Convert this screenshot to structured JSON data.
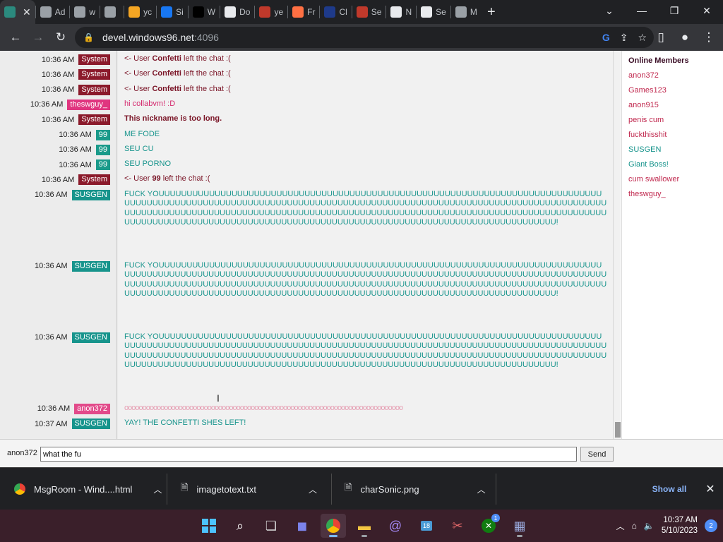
{
  "browser": {
    "tabs": [
      {
        "label": "",
        "color": "#2b8a7e",
        "active": true
      },
      {
        "label": "Ad",
        "color": "#9aa0a6"
      },
      {
        "label": "w",
        "color": "#9aa0a6"
      },
      {
        "label": "",
        "color": "#9aa0a6"
      },
      {
        "label": "yc",
        "color": "#f5a623"
      },
      {
        "label": "Si",
        "color": "#1877f2"
      },
      {
        "label": "W",
        "color": "#000000"
      },
      {
        "label": "Do",
        "color": "#e8eaed"
      },
      {
        "label": "ye",
        "color": "#c0392b"
      },
      {
        "label": "Fr",
        "color": "#ff7043"
      },
      {
        "label": "Cl",
        "color": "#1e3a8a"
      },
      {
        "label": "Se",
        "color": "#c0392b"
      },
      {
        "label": "N",
        "color": "#e8eaed"
      },
      {
        "label": "Se",
        "color": "#e8eaed"
      },
      {
        "label": "M",
        "color": "#9aa0a6"
      }
    ],
    "address_host": "devel.windows96.net",
    "address_port": ":4096"
  },
  "chat": {
    "messages": [
      {
        "time": "10:36 AM",
        "user": "System",
        "kind": "system",
        "prefix": "<- User ",
        "bold": "Confetti",
        "suffix": " left the chat :("
      },
      {
        "time": "10:36 AM",
        "user": "System",
        "kind": "system",
        "prefix": "<- User ",
        "bold": "Confetti",
        "suffix": " left the chat :("
      },
      {
        "time": "10:36 AM",
        "user": "System",
        "kind": "system",
        "prefix": "<- User ",
        "bold": "Confetti",
        "suffix": " left the chat :("
      },
      {
        "time": "10:36 AM",
        "user": "theswguy_",
        "kind": "swguy",
        "text": "hi collabvm! :D"
      },
      {
        "time": "10:36 AM",
        "user": "System",
        "kind": "system",
        "prefix": "",
        "bold": "This nickname is too long.",
        "suffix": ""
      },
      {
        "time": "10:36 AM",
        "user": "99",
        "kind": "n99",
        "text": "ME FODE"
      },
      {
        "time": "10:36 AM",
        "user": "99",
        "kind": "n99",
        "text": "SEU CU"
      },
      {
        "time": "10:36 AM",
        "user": "99",
        "kind": "n99",
        "text": "SEU PORNO"
      },
      {
        "time": "10:36 AM",
        "user": "System",
        "kind": "system",
        "prefix": "<- User ",
        "bold": "99",
        "suffix": " left the chat :("
      },
      {
        "time": "10:36 AM",
        "user": "SUSGEN",
        "kind": "susgen",
        "text": "FUCK YOUUUUUUUUUUUUUUUUUUUUUUUUUUUUUUUUUUUUUUUUUUUUUUUUUUUUUUUUUUUUUUUUUUUUUUUUUUUUUUUUUUUUUUUUUUUUUUUUUUUUUUUUUUUUUUUUUUUUUUUUUUUUUUUUUUUUUUUUUUUUUUUUUUUUUUUUUUUUUUUUUUUUUUUUUUUUUUUUUUUUUUUUUUUUUUUUUUUUUUUUUUUUUUUUUUUUUUUUUUUUUUUUUUUUUUUUUUUUUUUUUUUUUUUUUUUUUUUUUUUUUUUUUUUUUUUUUUUUUUUUUUUUUUUUUUUUUUUUUUUUUUUUUUUUUUUUUUUUUUUUUUUUUUUU!"
      },
      {
        "time": "10:36 AM",
        "user": "SUSGEN",
        "kind": "susgen",
        "text": "FUCK YOUUUUUUUUUUUUUUUUUUUUUUUUUUUUUUUUUUUUUUUUUUUUUUUUUUUUUUUUUUUUUUUUUUUUUUUUUUUUUUUUUUUUUUUUUUUUUUUUUUUUUUUUUUUUUUUUUUUUUUUUUUUUUUUUUUUUUUUUUUUUUUUUUUUUUUUUUUUUUUUUUUUUUUUUUUUUUUUUUUUUUUUUUUUUUUUUUUUUUUUUUUUUUUUUUUUUUUUUUUUUUUUUUUUUUUUUUUUUUUUUUUUUUUUUUUUUUUUUUUUUUUUUUUUUUUUUUUUUUUUUUUUUUUUUUUUUUUUUUUUUUUUUUUUUUUUUUUUUUUUUUUUUUUUU!"
      },
      {
        "time": "10:36 AM",
        "user": "SUSGEN",
        "kind": "susgen",
        "text": "FUCK YOUUUUUUUUUUUUUUUUUUUUUUUUUUUUUUUUUUUUUUUUUUUUUUUUUUUUUUUUUUUUUUUUUUUUUUUUUUUUUUUUUUUUUUUUUUUUUUUUUUUUUUUUUUUUUUUUUUUUUUUUUUUUUUUUUUUUUUUUUUUUUUUUUUUUUUUUUUUUUUUUUUUUUUUUUUUUUUUUUUUUUUUUUUUUUUUUUUUUUUUUUUUUUUUUUUUUUUUUUUUUUUUUUUUUUUUUUUUUUUUUUUUUUUUUUUUUUUUUUUUUUUUUUUUUUUUUUUUUUUUUUUUUUUUUUUUUUUUUUUUUUUUUUUUUUUUUUUUUUUUUUUUUUUUU!"
      },
      {
        "time": "10:36 AM",
        "user": "anon372",
        "kind": "anon",
        "text": "ooooooooooooooooooooooooooooooooooooooooooooooooooooooooooooooooooooooooooooo"
      },
      {
        "time": "10:37 AM",
        "user": "SUSGEN",
        "kind": "susgen",
        "text": "YAY! THE CONFETTI SHES LEFT!"
      }
    ]
  },
  "sidebar": {
    "title": "Online Members",
    "members": [
      {
        "name": "anon372",
        "color": "red"
      },
      {
        "name": "Games123",
        "color": "red"
      },
      {
        "name": "anon915",
        "color": "red"
      },
      {
        "name": "penis cum",
        "color": "red"
      },
      {
        "name": "fuckthisshit",
        "color": "red"
      },
      {
        "name": "SUSGEN",
        "color": "teal"
      },
      {
        "name": "Giant Boss!",
        "color": "teal"
      },
      {
        "name": "cum swallower",
        "color": "red"
      },
      {
        "name": "theswguy_",
        "color": "red"
      }
    ]
  },
  "input": {
    "nick": "anon372",
    "value": "what the fu",
    "send_label": "Send"
  },
  "downloads": {
    "items": [
      {
        "name": "MsgRoom - Wind....html",
        "icon": "chrome-file-icon"
      },
      {
        "name": "imagetotext.txt",
        "icon": "text-file-icon"
      },
      {
        "name": "charSonic.png",
        "icon": "image-file-icon"
      }
    ],
    "show_all": "Show all"
  },
  "taskbar": {
    "time": "10:37 AM",
    "date": "5/10/2023",
    "notifications": "2",
    "xbox_badge": "1",
    "calendar_day": "18"
  }
}
